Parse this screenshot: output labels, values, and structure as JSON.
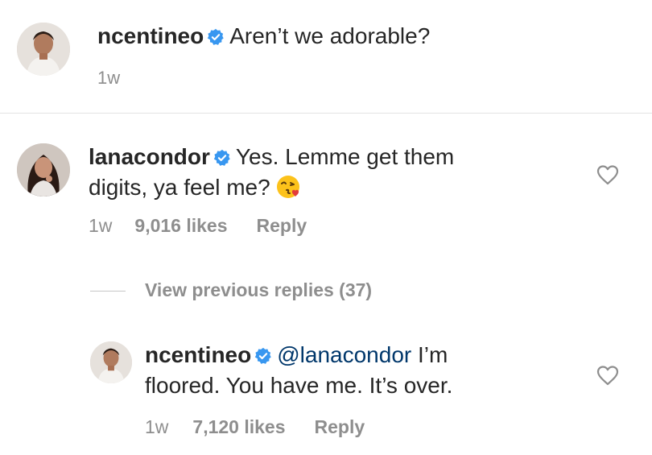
{
  "caption": {
    "username": "ncentineo",
    "text": "Aren’t we adorable?",
    "time": "1w"
  },
  "comment": {
    "username": "lanacondor",
    "text_line1": "Yes. Lemme get them",
    "text_line2": "digits, ya feel me?",
    "emoji": "face-blowing-kiss-emoji",
    "time": "1w",
    "likes": "9,016 likes",
    "reply_label": "Reply"
  },
  "view_previous": "View previous replies (37)",
  "reply": {
    "username": "ncentineo",
    "mention": "@lanacondor",
    "text_line1_suffix": " I’m",
    "text_line2": "floored. You have me. It’s over.",
    "time": "1w",
    "likes": "7,120 likes",
    "reply_label": "Reply"
  },
  "icons": {
    "verified": "verified-badge-icon",
    "like": "heart-outline-icon"
  },
  "colors": {
    "verified_blue": "#3897f0",
    "text": "#262626",
    "secondary": "#8e8e8e",
    "mention": "#00376b"
  }
}
